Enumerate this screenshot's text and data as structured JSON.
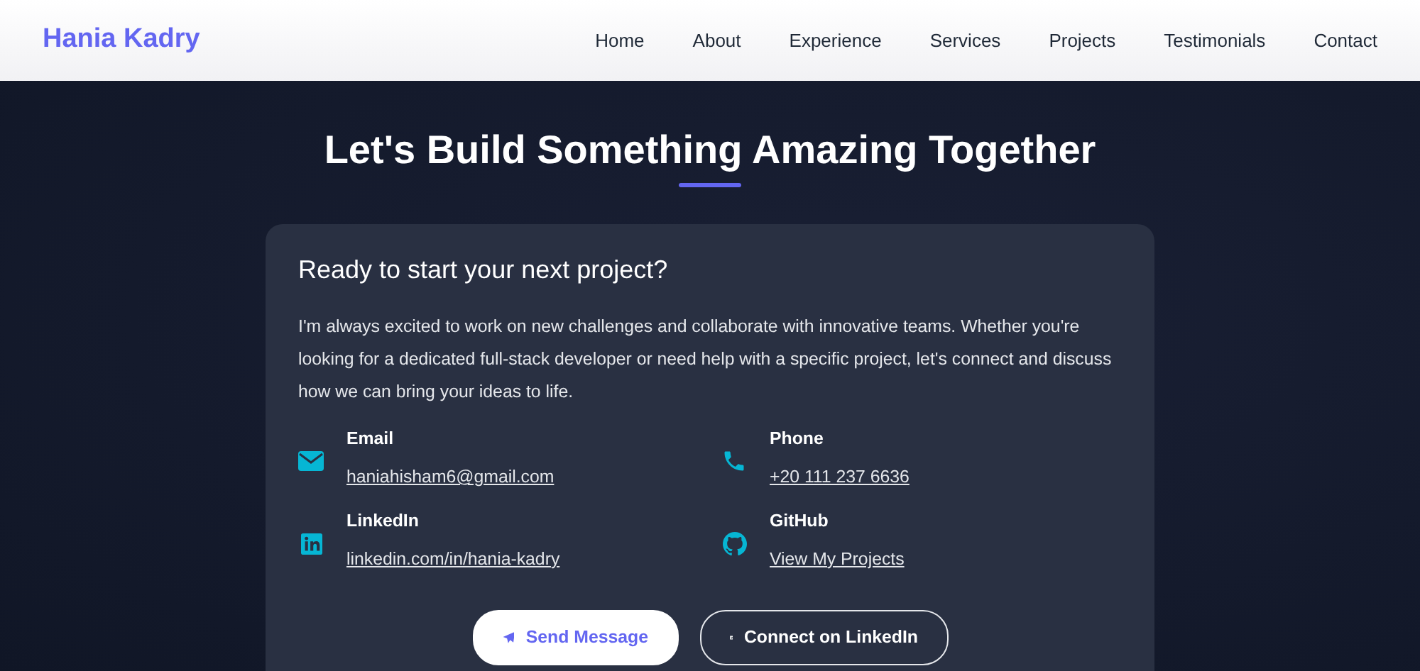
{
  "brand": "Hania Kadry",
  "nav": [
    {
      "label": "Home"
    },
    {
      "label": "About"
    },
    {
      "label": "Experience"
    },
    {
      "label": "Services"
    },
    {
      "label": "Projects"
    },
    {
      "label": "Testimonials"
    },
    {
      "label": "Contact"
    }
  ],
  "section_title": "Let's Build Something Amazing Together",
  "card": {
    "heading": "Ready to start your next project?",
    "paragraph": "I'm always excited to work on new challenges and collaborate with innovative teams. Whether you're looking for a dedicated full-stack developer or need help with a specific project, let's connect and discuss how we can bring your ideas to life.",
    "contacts": [
      {
        "kind": "email",
        "label": "Email",
        "link": "haniahisham6@gmail.com"
      },
      {
        "kind": "phone",
        "label": "Phone",
        "link": "+20 111 237 6636"
      },
      {
        "kind": "linkedin",
        "label": "LinkedIn",
        "link": "linkedin.com/in/hania-kadry"
      },
      {
        "kind": "github",
        "label": "GitHub",
        "link": "View My Projects"
      }
    ],
    "buttons": [
      {
        "kind": "send",
        "label": "Send Message"
      },
      {
        "kind": "linkedin",
        "label": "Connect on LinkedIn"
      }
    ]
  }
}
